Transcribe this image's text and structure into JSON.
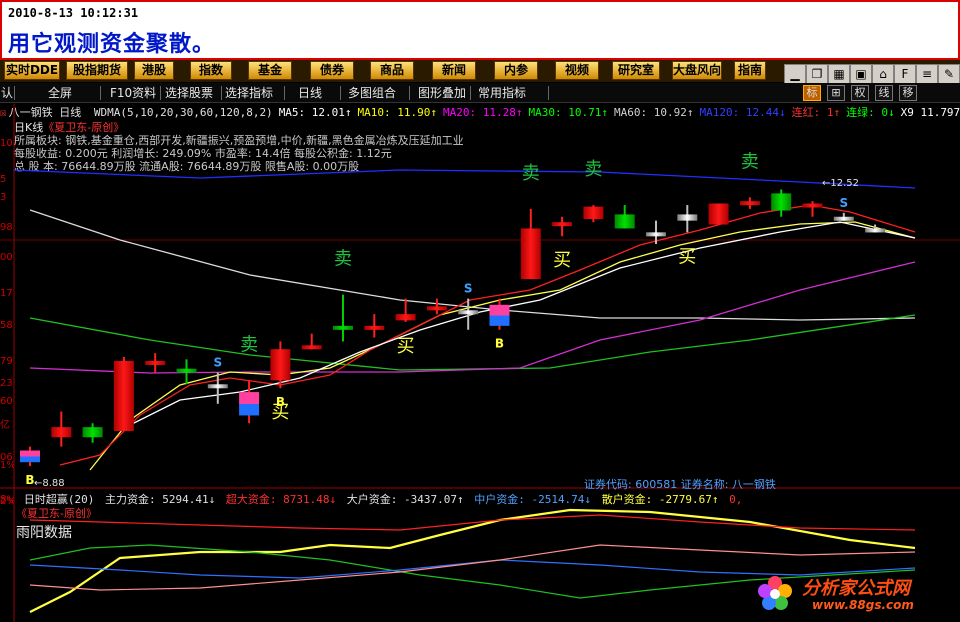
{
  "banner": {
    "datetime": "2010-8-13 10:12:31",
    "title": "用它观测资金聚散。"
  },
  "nav": [
    "实时DDE",
    "股指期货",
    "港股",
    "指数",
    "基金",
    "债券",
    "商品",
    "新闻",
    "内参",
    "视频",
    "研究室",
    "大盘风向",
    "指南"
  ],
  "toolbar": {
    "left_cut": "认",
    "fullscreen": "全屏",
    "f10": "F10资料",
    "select_stock": "选择股票",
    "select_indicator": "选择指标",
    "period": "日线",
    "multi": "多图组合",
    "overlay": "图形叠加",
    "common": "常用指标",
    "right": [
      "标",
      "⊞",
      "权",
      "线",
      "移"
    ]
  },
  "ma_bar": {
    "name": "八一钢铁 日线",
    "items": [
      {
        "text": "WDMA(5,10,20,30,60,120,8,2)",
        "color": "#e0e0e0"
      },
      {
        "text": "MA5: 12.01↑",
        "color": "#ffffff"
      },
      {
        "text": "MA10: 11.90↑",
        "color": "#ffff00"
      },
      {
        "text": "MA20: 11.28↑",
        "color": "#ff00ff"
      },
      {
        "text": "MA30: 10.71↑",
        "color": "#00ff00"
      },
      {
        "text": "MA60: 10.92↑",
        "color": "#d0d0d0"
      },
      {
        "text": "MA120: 12.44↓",
        "color": "#3040ff"
      },
      {
        "text": "连红: 1↑",
        "color": "#ff3030"
      },
      {
        "text": "连绿: 0↓",
        "color": "#00ff00"
      },
      {
        "text": "X9 11.797↓",
        "color": "#ffffff"
      }
    ]
  },
  "info": {
    "line0": "日K线",
    "brand": "《夏卫东-原创》",
    "line1": "所属板块: 钢铁,基金重仓,西部开发,新疆振兴,预盈预增,中价,新疆,黑色金属冶炼及压延加工业",
    "line2": "每股收益: 0.200元   利润增长: 249.09%   市盈率: 14.4倍   每股公积金: 1.12元",
    "line3": "总 股 本: 76644.89万股   流通A股: 76644.89万股   限售A股: 0.00万股"
  },
  "axis_left": [
    "10",
    "5",
    "3",
    "98",
    "00",
    "17",
    "58",
    "79",
    "23",
    "60",
    "亿",
    "06",
    "1%",
    "2%"
  ],
  "chart_data": {
    "type": "candlestick",
    "y_ticks_visible": false,
    "candles": [
      {
        "o": 8.95,
        "c": 8.8,
        "h": 9.0,
        "l": 8.75,
        "style": "blue"
      },
      {
        "o": 9.25,
        "c": 9.12,
        "h": 9.45,
        "l": 9.0,
        "style": "red"
      },
      {
        "o": 9.25,
        "c": 9.12,
        "h": 9.3,
        "l": 9.05,
        "style": "green"
      },
      {
        "o": 9.2,
        "c": 10.1,
        "h": 10.15,
        "l": 9.2,
        "style": "red"
      },
      {
        "o": 10.05,
        "c": 10.1,
        "h": 10.2,
        "l": 9.95,
        "style": "red"
      },
      {
        "o": 9.95,
        "c": 10.0,
        "h": 10.12,
        "l": 9.8,
        "style": "green"
      },
      {
        "o": 9.8,
        "c": 9.75,
        "h": 9.95,
        "l": 9.55,
        "style": "gray"
      },
      {
        "o": 9.4,
        "c": 9.7,
        "h": 9.85,
        "l": 9.3,
        "style": "blue"
      },
      {
        "o": 10.25,
        "c": 9.85,
        "h": 10.35,
        "l": 9.75,
        "style": "red"
      },
      {
        "o": 10.28,
        "c": 10.3,
        "h": 10.45,
        "l": 10.25,
        "style": "red"
      },
      {
        "o": 10.52,
        "c": 10.55,
        "h": 10.95,
        "l": 10.35,
        "style": "green"
      },
      {
        "o": 10.55,
        "c": 10.5,
        "h": 10.7,
        "l": 10.4,
        "style": "red"
      },
      {
        "o": 10.7,
        "c": 10.62,
        "h": 10.9,
        "l": 10.6,
        "style": "red"
      },
      {
        "o": 10.78,
        "c": 10.8,
        "h": 10.9,
        "l": 10.7,
        "style": "red"
      },
      {
        "o": 10.75,
        "c": 10.72,
        "h": 10.9,
        "l": 10.5,
        "style": "gray"
      },
      {
        "o": 10.55,
        "c": 10.82,
        "h": 10.9,
        "l": 10.5,
        "style": "blue"
      },
      {
        "o": 11.15,
        "c": 11.8,
        "h": 12.05,
        "l": 11.15,
        "style": "red"
      },
      {
        "o": 11.88,
        "c": 11.85,
        "h": 11.95,
        "l": 11.7,
        "style": "red"
      },
      {
        "o": 12.08,
        "c": 11.92,
        "h": 12.1,
        "l": 11.88,
        "style": "red"
      },
      {
        "o": 11.98,
        "c": 11.8,
        "h": 12.1,
        "l": 11.8,
        "style": "green"
      },
      {
        "o": 11.75,
        "c": 11.75,
        "h": 11.9,
        "l": 11.6,
        "style": "gray"
      },
      {
        "o": 11.98,
        "c": 11.9,
        "h": 12.1,
        "l": 11.75,
        "style": "gray"
      },
      {
        "o": 11.85,
        "c": 12.12,
        "h": 12.12,
        "l": 11.85,
        "style": "red"
      },
      {
        "o": 12.12,
        "c": 12.15,
        "h": 12.2,
        "l": 12.05,
        "style": "red"
      },
      {
        "o": 12.25,
        "c": 12.03,
        "h": 12.3,
        "l": 11.95,
        "style": "green"
      },
      {
        "o": 12.12,
        "c": 12.1,
        "h": 12.15,
        "l": 11.95,
        "style": "red"
      },
      {
        "o": 11.95,
        "c": 11.92,
        "h": 12.0,
        "l": 11.9,
        "style": "gray"
      },
      {
        "o": 11.8,
        "c": 11.75,
        "h": 11.85,
        "l": 11.75,
        "style": "gray"
      }
    ],
    "signals": [
      {
        "idx": 7,
        "text": "卖",
        "pos": "above"
      },
      {
        "idx": 8,
        "text": "买",
        "pos": "below"
      },
      {
        "idx": 10,
        "text": "卖",
        "pos": "above"
      },
      {
        "idx": 12,
        "text": "买",
        "pos": "below"
      },
      {
        "idx": 16,
        "text": "卖",
        "pos": "above"
      },
      {
        "idx": 17,
        "text": "买",
        "pos": "below"
      },
      {
        "idx": 18,
        "text": "卖",
        "pos": "above"
      },
      {
        "idx": 21,
        "text": "买",
        "pos": "below"
      },
      {
        "idx": 23,
        "text": "卖",
        "pos": "above"
      }
    ],
    "markers": [
      {
        "idx": 0,
        "text": "B"
      },
      {
        "idx": 8,
        "text": "B"
      },
      {
        "idx": 15,
        "text": "B"
      },
      {
        "idx": 6,
        "text": "S"
      },
      {
        "idx": 14,
        "text": "S"
      },
      {
        "idx": 26,
        "text": "S"
      }
    ],
    "low_label": "8.88",
    "high_label": "12.52"
  },
  "stock": {
    "code_label": "证券代码:",
    "code": "600581",
    "name_label": "证券名称:",
    "name": "八一钢铁"
  },
  "indicator": {
    "prefix": "8%",
    "name": "日时超赢(20)",
    "items": [
      {
        "text": "主力资金: 5294.41↓",
        "color": "#e0e0e0"
      },
      {
        "text": "超大资金: 8731.48↓",
        "color": "#ff3030"
      },
      {
        "text": "大户资金: -3437.07↑",
        "color": "#e0e0e0"
      },
      {
        "text": "中户资金: -2514.74↓",
        "color": "#50a0ff"
      },
      {
        "text": "散户资金: -2779.67↑",
        "color": "#ffff40"
      },
      {
        "text": "0,",
        "color": "#ff3030"
      }
    ],
    "brand": "《夏卫东-原创》",
    "sub": "雨阳数据"
  },
  "watermark": {
    "cn": "分析家公式网",
    "url": "www.88gs.com"
  },
  "colors": {
    "up": "#ff2020",
    "down": "#00c000",
    "bg": "#000000"
  }
}
